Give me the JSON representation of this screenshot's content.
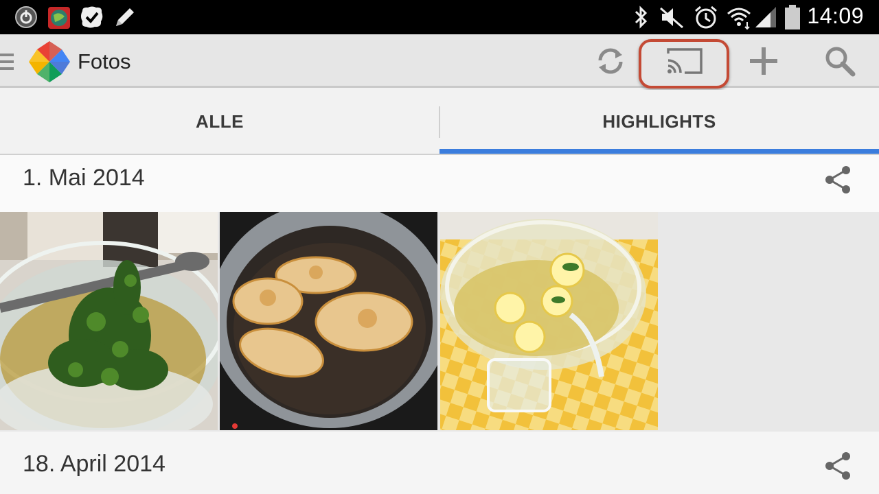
{
  "status_bar": {
    "time": "14:09",
    "left_icons": [
      "power-icon",
      "globe-app-icon",
      "check-chat-icon",
      "pencil-icon"
    ],
    "right_icons": [
      "bluetooth-icon",
      "mute-icon",
      "alarm-icon",
      "wifi-icon",
      "signal-icon",
      "battery-icon"
    ]
  },
  "app_bar": {
    "title": "Fotos",
    "actions": [
      "sync-icon",
      "cast-icon",
      "add-icon",
      "search-icon"
    ],
    "highlight_color": "#c44a35"
  },
  "tabs": [
    {
      "label": "ALLE",
      "selected": false
    },
    {
      "label": "HIGHLIGHTS",
      "selected": true
    }
  ],
  "accent_color": "#3b7ddd",
  "sections": [
    {
      "date": "1. Mai 2014",
      "photos": [
        "salad-bowl-photo",
        "pancakes-pan-photo",
        "lemon-punch-photo"
      ]
    },
    {
      "date": "18. April 2014",
      "photos": []
    }
  ]
}
